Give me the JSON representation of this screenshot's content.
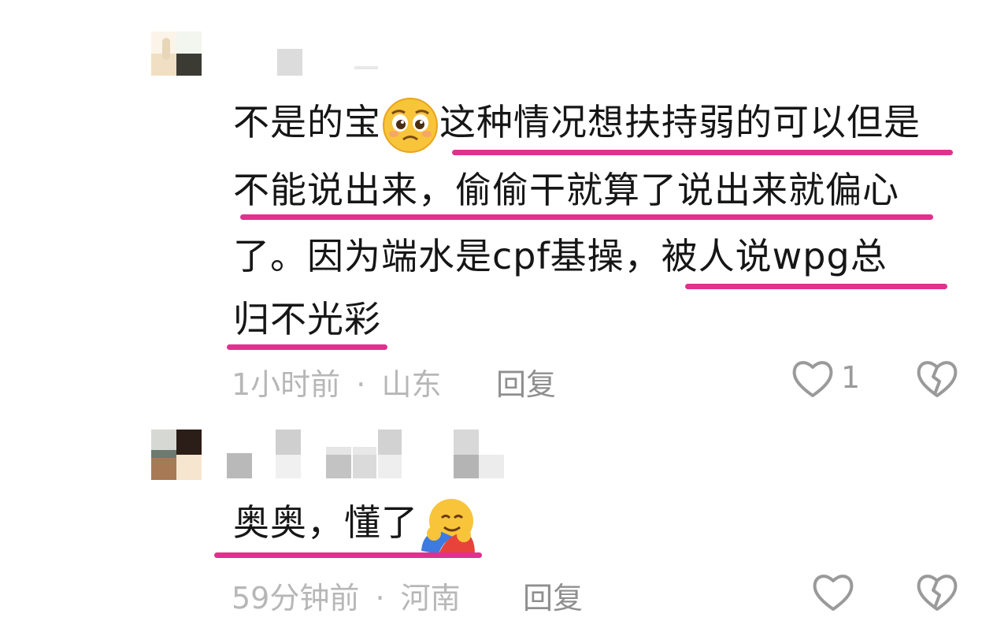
{
  "comments": [
    {
      "lines": [
        {
          "before": "不是的宝",
          "emoji": "pleading-face-emoji",
          "after": "这种情况想扶持弱的可以但是"
        },
        {
          "text": "不能说出来，偷偷干就算了说出来就偏心"
        },
        {
          "text": "了。因为端水是cpf基操，被人说wpg总"
        },
        {
          "text": "归不光彩"
        }
      ],
      "time": "1小时前",
      "separator": "·",
      "location": "山东",
      "reply": "回复",
      "like_count": "1"
    },
    {
      "before": "奥奥，懂了",
      "emoji": "hugging-face-emoji",
      "time": "59分钟前",
      "separator": "·",
      "location": "河南",
      "reply": "回复",
      "like_count": ""
    }
  ],
  "colors": {
    "underline": "#e0318e",
    "meta": "#b7b7b7",
    "reply": "#8f8f8f"
  }
}
